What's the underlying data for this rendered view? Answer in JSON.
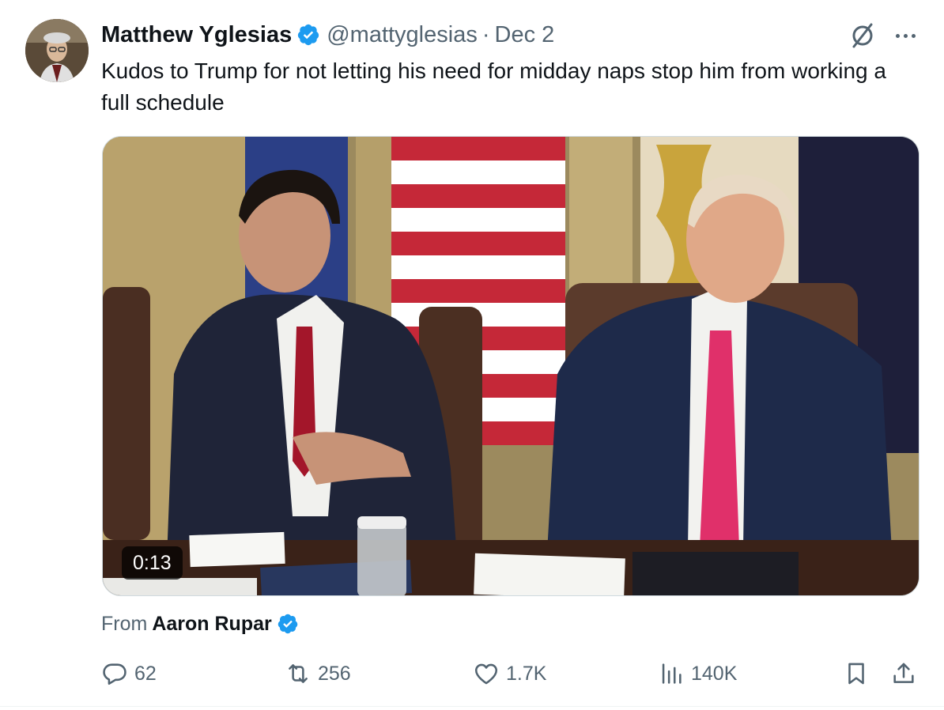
{
  "author": {
    "display_name": "Matthew Yglesias",
    "handle": "@mattyglesias",
    "separator": "·",
    "date": "Dec 2"
  },
  "tweet": {
    "text": "Kudos to Trump for not letting his need for midday naps stop him from working a full schedule"
  },
  "media": {
    "video_timestamp": "0:13"
  },
  "attribution": {
    "label": "From",
    "name": "Aaron Rupar"
  },
  "actions": {
    "replies": "62",
    "reposts": "256",
    "likes": "1.7K",
    "views": "140K"
  },
  "icons": {
    "verified": "verified-badge-icon",
    "grok": "grok-icon",
    "more": "more-icon",
    "reply": "reply-icon",
    "repost": "repost-icon",
    "like": "heart-icon",
    "views": "views-icon",
    "bookmark": "bookmark-icon",
    "share": "share-icon"
  },
  "colors": {
    "verified_blue": "#1d9bf0",
    "text_primary": "#0f1419",
    "text_secondary": "#536471"
  }
}
